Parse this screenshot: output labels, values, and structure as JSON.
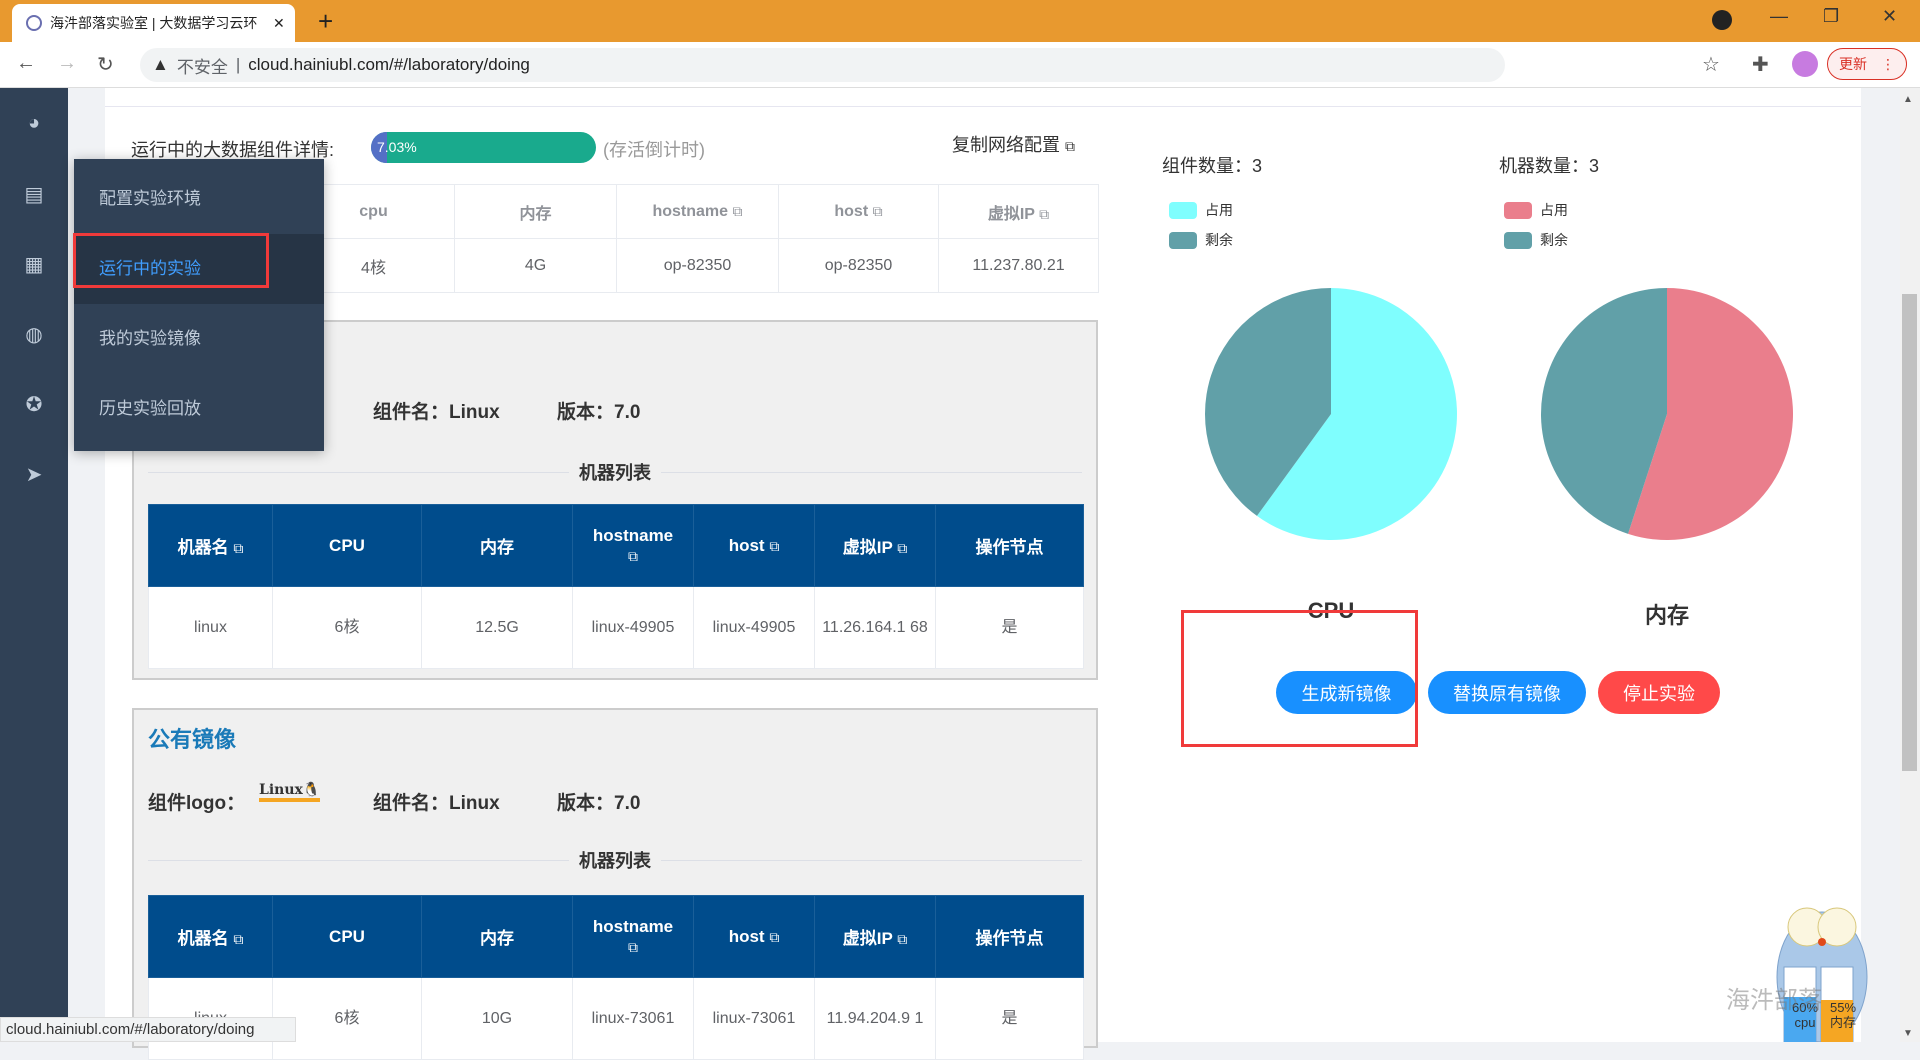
{
  "browser": {
    "tab_title": "海汼部落实验室 | 大数据学习云环",
    "insecure_label": "不安全",
    "url": "cloud.hainiubl.com/#/laboratory/doing",
    "update_label": "更新",
    "status_url": "cloud.hainiubl.com/#/laboratory/doing"
  },
  "sidebar": {
    "icons": [
      "dashboard-icon",
      "document-icon",
      "apps-icon",
      "globe-icon",
      "lifebuoy-icon",
      "send-icon"
    ]
  },
  "menu": {
    "items": [
      {
        "label": "配置实验环境"
      },
      {
        "label": "运行中的实验",
        "active": true
      },
      {
        "label": "我的实验镜像"
      },
      {
        "label": "历史实验回放"
      }
    ]
  },
  "running": {
    "title": "运行中的大数据组件详情:",
    "progress_label": "7.03%",
    "progress": 7.03,
    "countdown_label": "(存活倒计时)",
    "copy_config": "复制网络配置",
    "headers": [
      "",
      "cpu",
      "内存",
      "hostname",
      "host",
      "虚拟IP"
    ],
    "row": [
      "",
      "4核",
      "4G",
      "op-82350",
      "op-82350",
      "11.237.80.21"
    ]
  },
  "sections": [
    {
      "heading": "",
      "logo_label": "",
      "name_label": "组件名：Linux",
      "version_label": "版本：7.0",
      "list_title": "机器列表",
      "headers": [
        "机器名",
        "CPU",
        "内存",
        "hostname",
        "host",
        "虚拟IP",
        "操作节点"
      ],
      "rows": [
        [
          "linux",
          "6核",
          "12.5G",
          "linux-49905",
          "linux-49905",
          "11.26.164.1 68",
          "是"
        ]
      ]
    },
    {
      "heading": "公有镜像",
      "logo_label": "组件logo：",
      "logo_text": "Linux",
      "name_label": "组件名：Linux",
      "version_label": "版本：7.0",
      "list_title": "机器列表",
      "headers": [
        "机器名",
        "CPU",
        "内存",
        "hostname",
        "host",
        "虚拟IP",
        "操作节点"
      ],
      "rows": [
        [
          "linux",
          "6核",
          "10G",
          "linux-73061",
          "linux-73061",
          "11.94.204.9 1",
          "是"
        ]
      ]
    }
  ],
  "stats": {
    "component_count": "组件数量：3",
    "machine_count": "机器数量：3",
    "legend_used": "占用",
    "legend_free": "剩余",
    "colors": {
      "cpu_used": "#7ffefe",
      "mem_used": "#ea7e8c",
      "free": "#61a0a8"
    }
  },
  "chart_data": [
    {
      "type": "pie",
      "title": "CPU",
      "labels": [
        "占用",
        "剩余"
      ],
      "values": [
        60,
        40
      ]
    },
    {
      "type": "pie",
      "title": "内存",
      "labels": [
        "占用",
        "剩余"
      ],
      "values": [
        55,
        45
      ]
    }
  ],
  "actions": {
    "new_image": "生成新镜像",
    "replace_image": "替换原有镜像",
    "stop": "停止实验"
  },
  "widget": {
    "cpu_pct": "60%",
    "cpu_label": "cpu",
    "mem_pct": "55%",
    "mem_label": "内存",
    "watermark": "海汼部落"
  }
}
